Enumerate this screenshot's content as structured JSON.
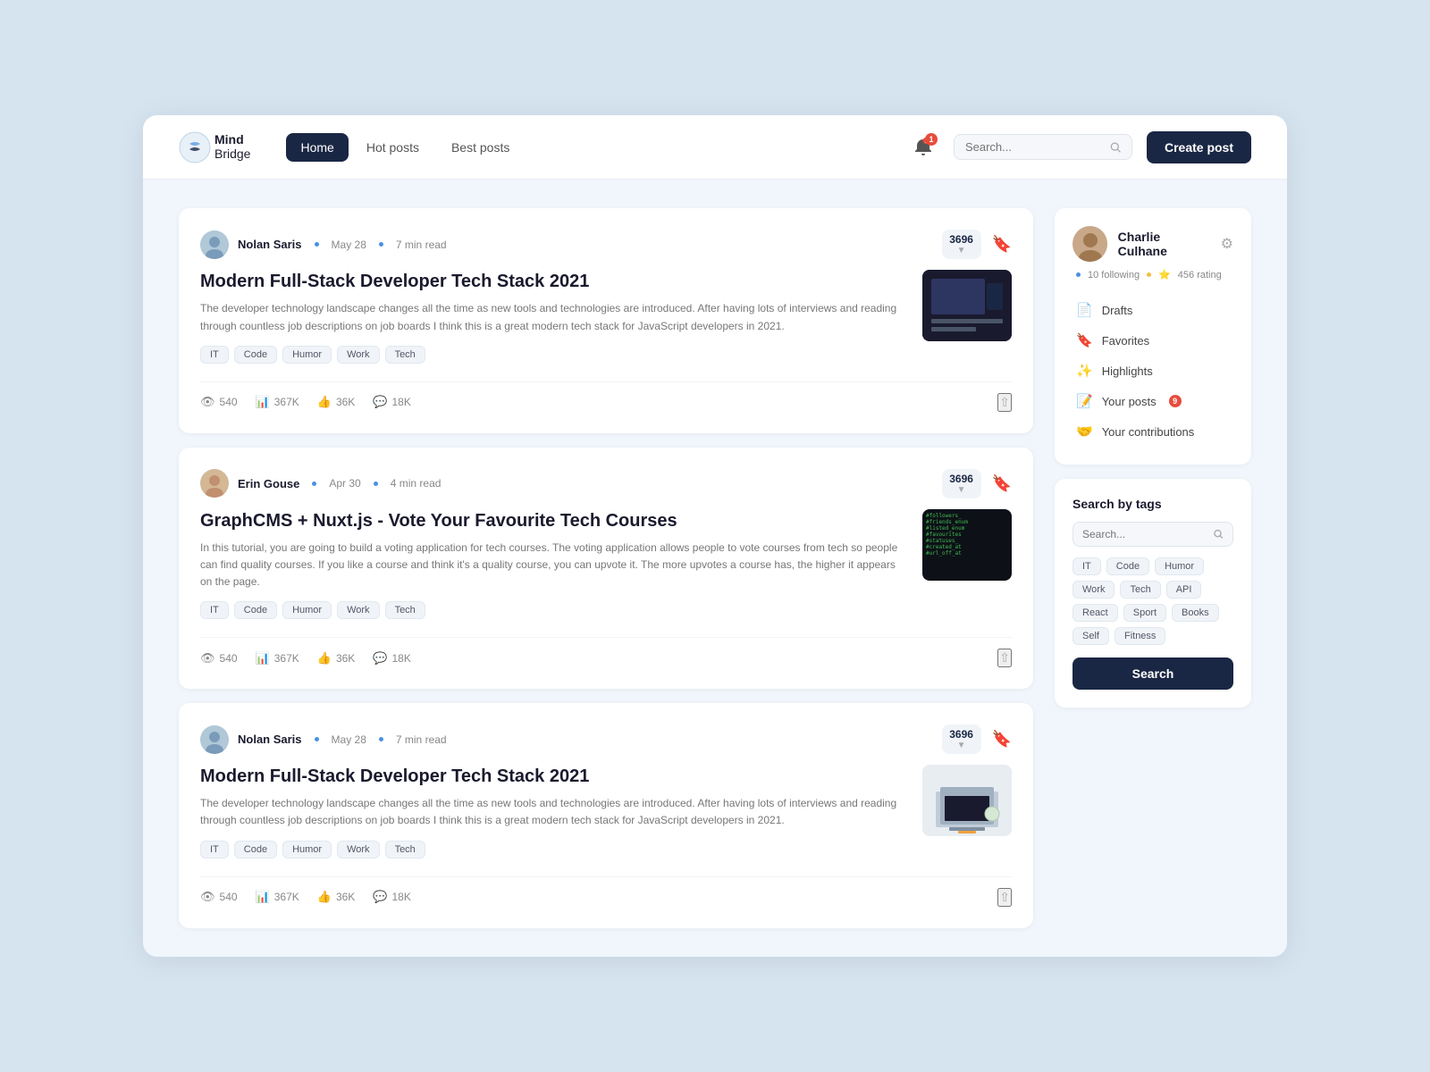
{
  "brand": {
    "name_line1": "Mind",
    "name_line2": "Bridge"
  },
  "nav": {
    "links": [
      {
        "label": "Home",
        "active": true
      },
      {
        "label": "Hot posts",
        "active": false
      },
      {
        "label": "Best posts",
        "active": false
      }
    ],
    "search_placeholder": "Search...",
    "create_post_label": "Create post",
    "notification_count": "1"
  },
  "posts": [
    {
      "id": 1,
      "author": "Nolan Saris",
      "date": "May 28",
      "read_time": "7 min read",
      "vote_count": "3696",
      "title": "Modern Full-Stack Developer Tech Stack 2021",
      "excerpt": "The developer technology landscape changes all the time as new tools and technologies are introduced. After having lots of interviews and reading through countless job descriptions on job boards I think this is a great modern tech stack for JavaScript developers in 2021.",
      "tags": [
        "IT",
        "Code",
        "Humor",
        "Work",
        "Tech"
      ],
      "stats": {
        "views1": "540",
        "views2": "367K",
        "likes": "36K",
        "comments": "18K"
      },
      "thumb_type": "dark"
    },
    {
      "id": 2,
      "author": "Erin Gouse",
      "date": "Apr 30",
      "read_time": "4 min read",
      "vote_count": "3696",
      "title": "GraphCMS + Nuxt.js - Vote Your Favourite Tech Courses",
      "excerpt": "In this tutorial, you are going to build a voting application for tech courses. The voting application allows people to vote courses from tech so people can find quality courses. If you like a course and think it's a quality course, you can upvote it. The more upvotes a course has, the higher it appears on the page.",
      "tags": [
        "IT",
        "Code",
        "Humor",
        "Work",
        "Tech"
      ],
      "stats": {
        "views1": "540",
        "views2": "367K",
        "likes": "36K",
        "comments": "18K"
      },
      "thumb_type": "code"
    },
    {
      "id": 3,
      "author": "Nolan Saris",
      "date": "May 28",
      "read_time": "7 min read",
      "vote_count": "3696",
      "title": "Modern Full-Stack Developer Tech Stack 2021",
      "excerpt": "The developer technology landscape changes all the time as new tools and technologies are introduced. After having lots of interviews and reading through countless job descriptions on job boards I think this is a great modern tech stack for JavaScript developers in 2021.",
      "tags": [
        "IT",
        "Code",
        "Humor",
        "Work",
        "Tech"
      ],
      "stats": {
        "views1": "540",
        "views2": "367K",
        "likes": "36K",
        "comments": "18K"
      },
      "thumb_type": "desk"
    }
  ],
  "sidebar": {
    "user": {
      "name": "Charlie Culhane",
      "following": "10 following",
      "rating": "456 rating"
    },
    "menu": [
      {
        "icon": "📄",
        "label": "Drafts"
      },
      {
        "icon": "🔖",
        "label": "Favorites"
      },
      {
        "icon": "✨",
        "label": "Highlights"
      },
      {
        "icon": "📝",
        "label": "Your posts",
        "badge": "9"
      },
      {
        "icon": "🤝",
        "label": "Your contributions"
      }
    ],
    "tags_section": {
      "title": "Search by tags",
      "search_placeholder": "Search...",
      "tags": [
        "IT",
        "Code",
        "Humor",
        "Work",
        "Tech",
        "API",
        "React",
        "Sport",
        "Books",
        "Self",
        "Fitness"
      ],
      "search_button": "Search"
    }
  }
}
